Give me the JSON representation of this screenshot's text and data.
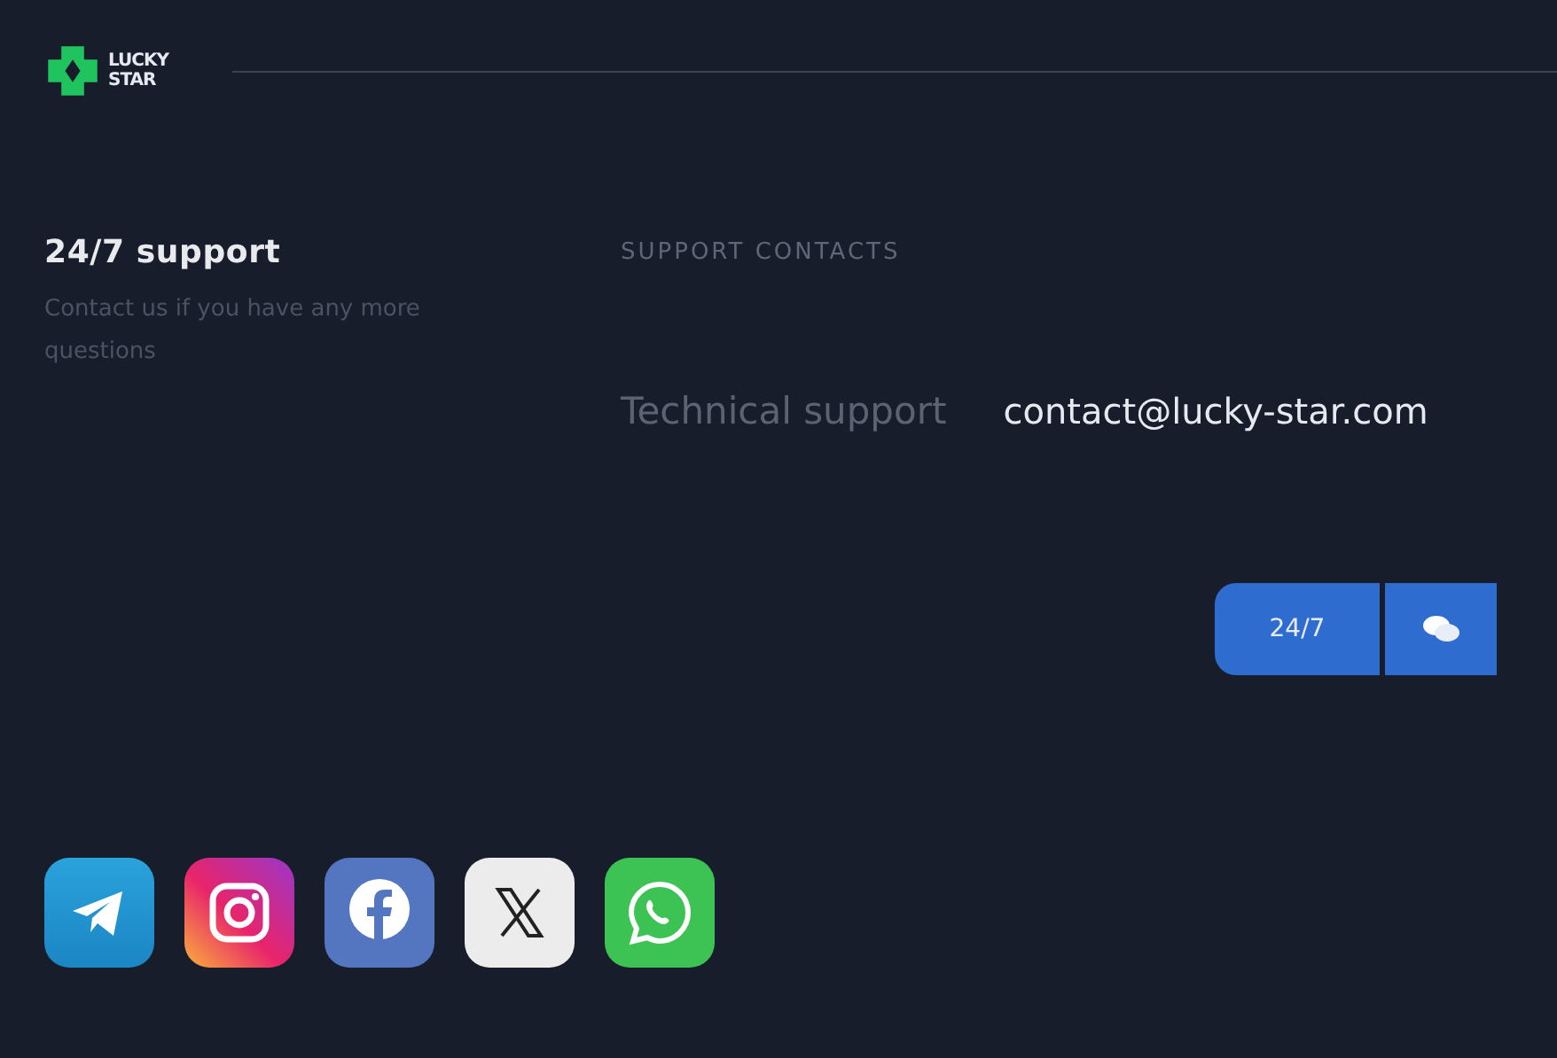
{
  "logo": {
    "line_1": "LUCKY",
    "line_2": "STAR"
  },
  "support": {
    "title": "24/7 support",
    "text": "Contact us if you have any more questions"
  },
  "contacts": {
    "heading": "SUPPORT CONTACTS",
    "rows": [
      {
        "label": "Technical support",
        "value": "contact@lucky-star.com"
      }
    ]
  },
  "chat_buttons": {
    "hours": "24/7"
  },
  "socials": [
    {
      "kind": "telegram"
    },
    {
      "kind": "instagram"
    },
    {
      "kind": "facebook"
    },
    {
      "kind": "x"
    },
    {
      "kind": "whatsapp"
    }
  ]
}
